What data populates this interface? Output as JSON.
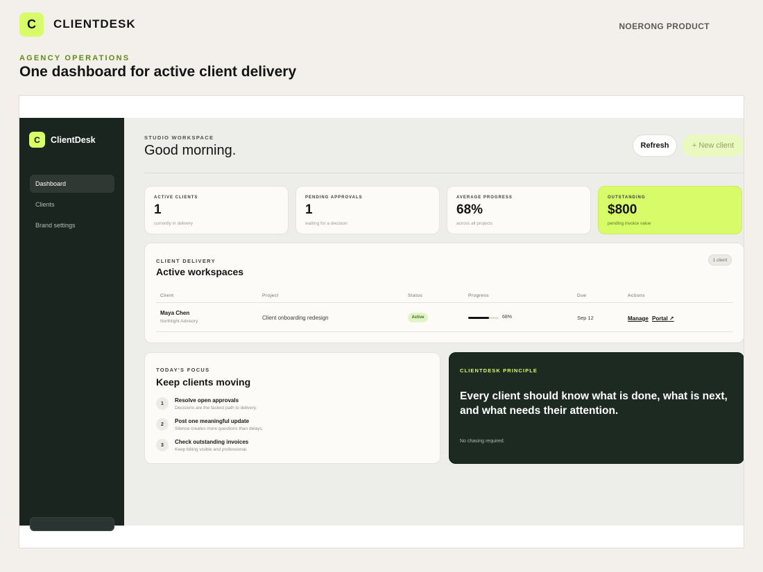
{
  "page": {
    "logo_letter": "C",
    "brand": "CLIENTDESK",
    "product_label": "NOERONG PRODUCT",
    "kicker": "AGENCY OPERATIONS",
    "headline": "One dashboard for active client delivery"
  },
  "app": {
    "sidebar": {
      "logo_letter": "C",
      "brand": "ClientDesk",
      "items": [
        {
          "label": "Dashboard",
          "active": true
        },
        {
          "label": "Clients",
          "active": false
        },
        {
          "label": "Brand settings",
          "active": false
        }
      ]
    },
    "header": {
      "kicker": "STUDIO WORKSPACE",
      "greeting": "Good morning.",
      "refresh_label": "Refresh",
      "new_client_label": "+ New client"
    },
    "stats": [
      {
        "label": "ACTIVE CLIENTS",
        "value": "1",
        "sub": "currently in delivery"
      },
      {
        "label": "PENDING APPROVALS",
        "value": "1",
        "sub": "waiting for a decision"
      },
      {
        "label": "AVERAGE PROGRESS",
        "value": "68%",
        "sub": "across all projects"
      },
      {
        "label": "OUTSTANDING",
        "value": "$800",
        "sub": "pending invoice value"
      }
    ],
    "delivery": {
      "kicker": "CLIENT DELIVERY",
      "title": "Active workspaces",
      "count_badge": "1 client",
      "columns": [
        "Client",
        "Project",
        "Status",
        "Progress",
        "Due",
        "Actions"
      ],
      "rows": [
        {
          "client": "Maya Chen",
          "org": "Northlight Advisory",
          "project": "Client onboarding redesign",
          "status": "Active",
          "progress": 68,
          "progress_label": "68%",
          "due": "Sep 12",
          "actions": [
            "Manage",
            "Portal ↗"
          ]
        }
      ]
    },
    "focus": {
      "kicker": "TODAY'S FOCUS",
      "title": "Keep clients moving",
      "items": [
        {
          "num": "1",
          "title": "Resolve open approvals",
          "desc": "Decisions are the fastest path to delivery."
        },
        {
          "num": "2",
          "title": "Post one meaningful update",
          "desc": "Silence creates more questions than delays."
        },
        {
          "num": "3",
          "title": "Check outstanding invoices",
          "desc": "Keep billing visible and professional."
        }
      ]
    },
    "principle": {
      "kicker": "CLIENTDESK PRINCIPLE",
      "quote": "Every client should know what is done, what is next, and what needs their attention.",
      "note": "No chasing required."
    }
  },
  "colors": {
    "accent_lime": "#d8fb6a",
    "sidebar_dark": "#1a2520",
    "principle_dark": "#1d2a22",
    "kicker_green": "#5f8a16",
    "page_bg": "#f3f0eb"
  }
}
